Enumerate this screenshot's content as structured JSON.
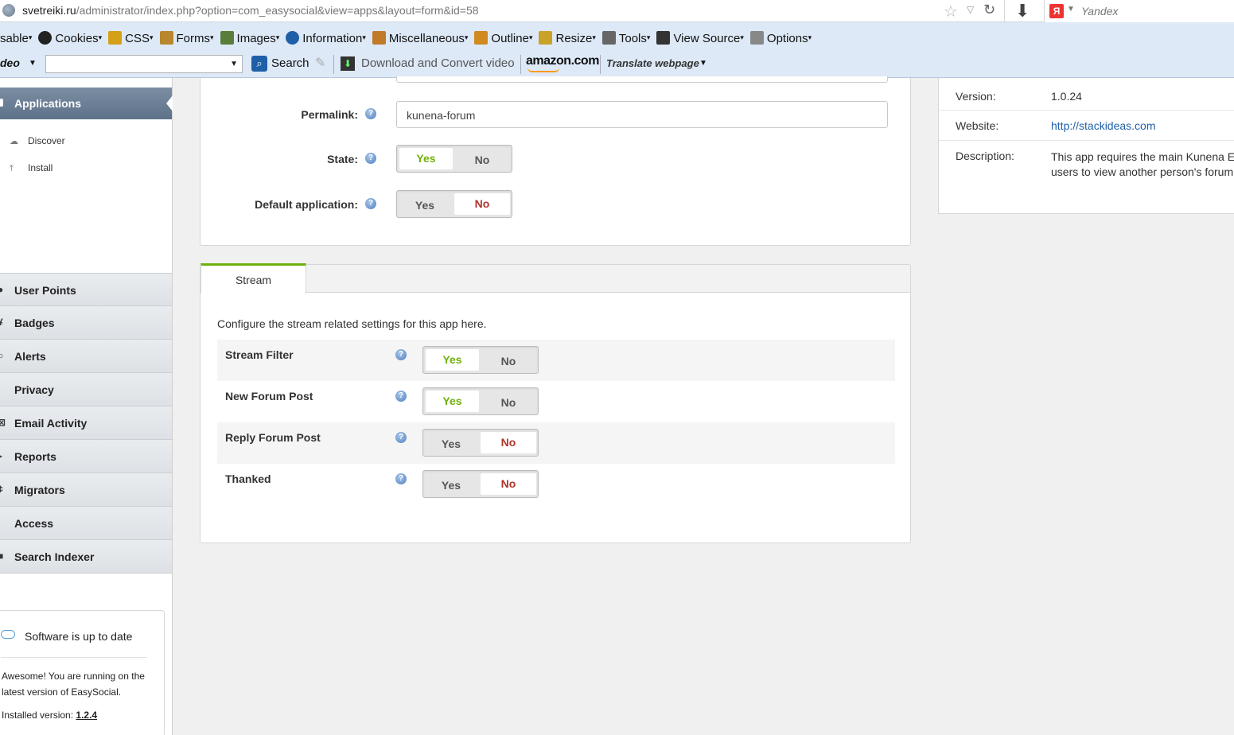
{
  "browser": {
    "url_host": "svetreiki.ru",
    "url_rest": "/administrator/index.php?option=com_easysocial&view=apps&layout=form&id=58",
    "search_engine": "Yandex",
    "search_logo": "Я"
  },
  "toolbar1": {
    "items": [
      {
        "label": "sable",
        "icon": ""
      },
      {
        "label": "Cookies",
        "icon": "person-icon"
      },
      {
        "label": "CSS",
        "icon": "wand-icon"
      },
      {
        "label": "Forms",
        "icon": "clipboard-icon"
      },
      {
        "label": "Images",
        "icon": "image-icon"
      },
      {
        "label": "Information",
        "icon": "info-icon"
      },
      {
        "label": "Miscellaneous",
        "icon": "book-icon"
      },
      {
        "label": "Outline",
        "icon": "pencil-icon"
      },
      {
        "label": "Resize",
        "icon": "ruler-icon"
      },
      {
        "label": "Tools",
        "icon": "tools-icon"
      },
      {
        "label": "View Source",
        "icon": "monitor-icon"
      },
      {
        "label": "Options",
        "icon": "options-icon"
      }
    ]
  },
  "toolbar2": {
    "deo": "deo",
    "search_label": "Search",
    "download_label": "Download and Convert video",
    "amazon_label": "amazon.com",
    "translate_label": "Translate webpage"
  },
  "sidebar": {
    "active": "Applications",
    "sub_items": [
      {
        "label": "Discover",
        "icon": "cloud-icon"
      },
      {
        "label": "Install",
        "icon": "upload-icon"
      }
    ],
    "nav": [
      {
        "label": "User Points",
        "icon": "●"
      },
      {
        "label": "Badges",
        "icon": "¥"
      },
      {
        "label": "Alerts",
        "icon": "○"
      },
      {
        "label": "Privacy",
        "icon": ""
      },
      {
        "label": "Email Activity",
        "icon": "⊠"
      },
      {
        "label": "Reports",
        "icon": "▸"
      },
      {
        "label": "Migrators",
        "icon": "¢"
      },
      {
        "label": "Access",
        "icon": ""
      },
      {
        "label": "Search Indexer",
        "icon": "■"
      }
    ],
    "status": {
      "title": "Software is up to date",
      "message": "Awesome! You are running on the latest version of EasySocial.",
      "installed_label": "Installed version:",
      "installed_version": "1.2.4"
    }
  },
  "form": {
    "permalink_label": "Permalink:",
    "permalink_value": "kunena-forum",
    "state_label": "State:",
    "state_value": "Yes",
    "default_label": "Default application:",
    "default_value": "No",
    "yes": "Yes",
    "no": "No"
  },
  "stream": {
    "tab": "Stream",
    "description": "Configure the stream related settings for this app here.",
    "rows": [
      {
        "label": "Stream Filter",
        "value": "Yes"
      },
      {
        "label": "New Forum Post",
        "value": "Yes"
      },
      {
        "label": "Reply Forum Post",
        "value": "No"
      },
      {
        "label": "Thanked",
        "value": "No"
      }
    ]
  },
  "info": {
    "version_label": "Version:",
    "version_value": "1.0.24",
    "website_label": "Website:",
    "website_value": "http://stackideas.com",
    "description_label": "Description:",
    "description_line1": "This app requires the main Kunena E",
    "description_line2": "users to view another person's forum"
  },
  "colors": {
    "yes_active": "#6fb10b",
    "no_active": "#b0332a",
    "tab_accent": "#6fb10b",
    "link": "#1f5fa8"
  }
}
